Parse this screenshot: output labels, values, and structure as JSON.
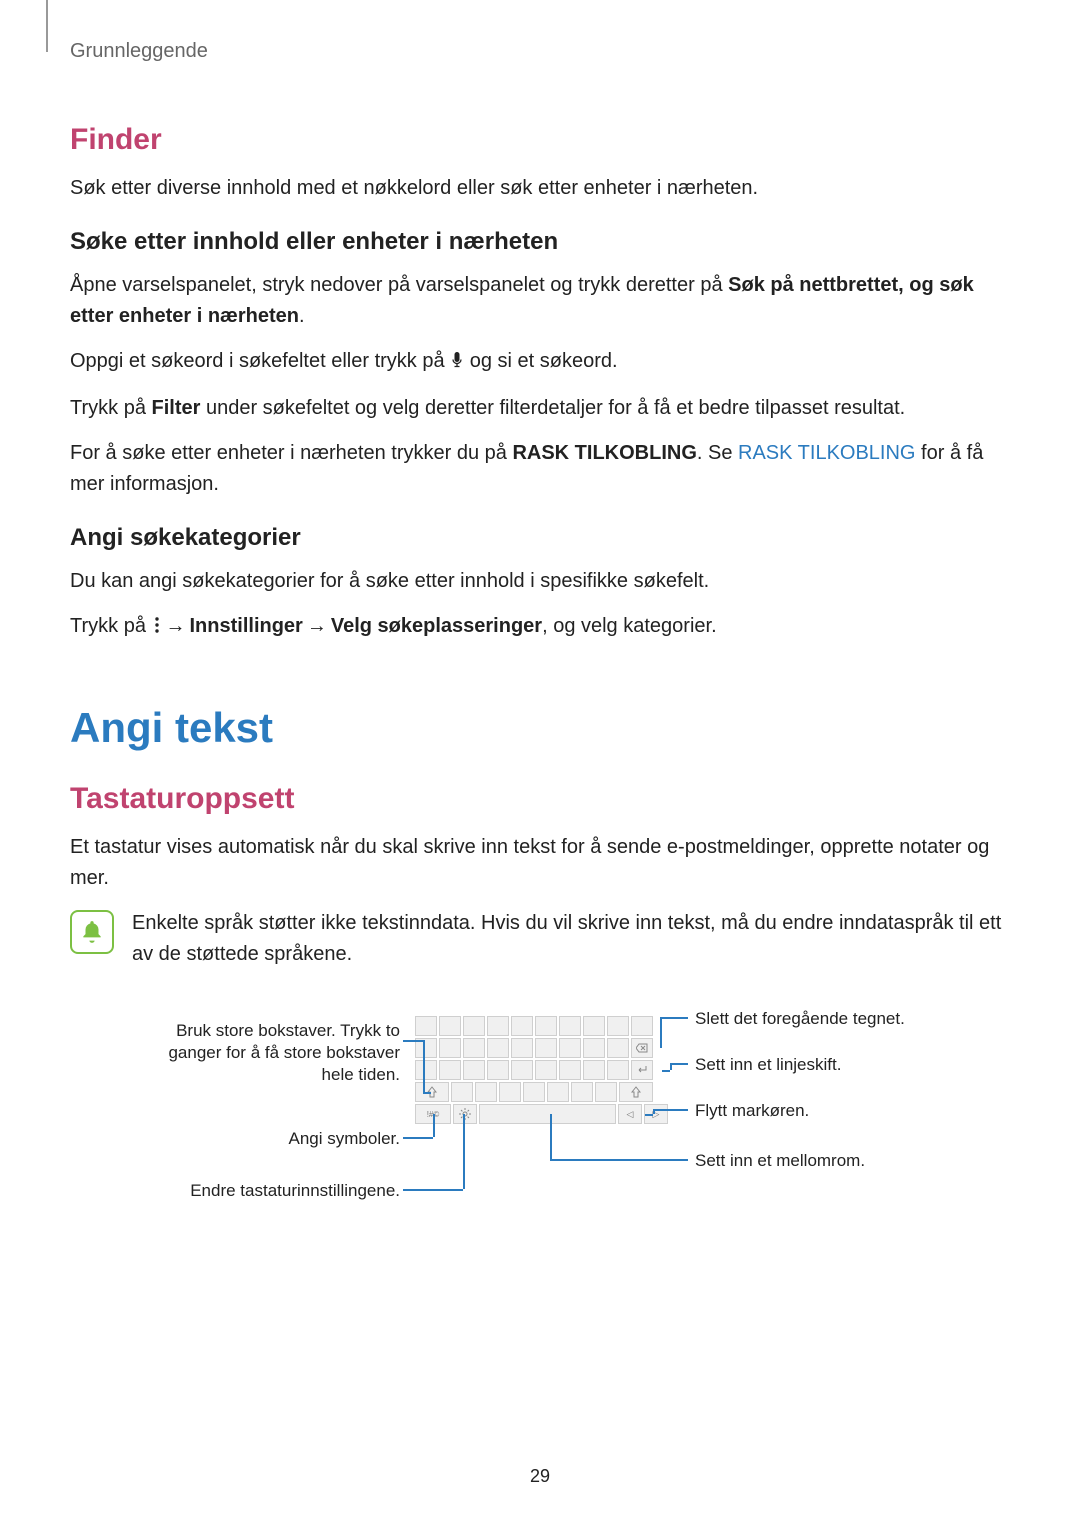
{
  "breadcrumb": "Grunnleggende",
  "finder": {
    "title": "Finder",
    "intro": "Søk etter diverse innhold med et nøkkelord eller søk etter enheter i nærheten.",
    "sub1_title": "Søke etter innhold eller enheter i nærheten",
    "sub1_p1_a": "Åpne varselspanelet, stryk nedover på varselspanelet og trykk deretter på ",
    "sub1_p1_b": "Søk på nettbrettet, og søk etter enheter i nærheten",
    "sub1_p1_c": ".",
    "sub1_p2_a": "Oppgi et søkeord i søkefeltet eller trykk på ",
    "sub1_p2_b": " og si et søkeord.",
    "sub1_p3_a": "Trykk på ",
    "sub1_p3_b": "Filter",
    "sub1_p3_c": " under søkefeltet og velg deretter filterdetaljer for å få et bedre tilpasset resultat.",
    "sub1_p4_a": "For å søke etter enheter i nærheten trykker du på ",
    "sub1_p4_b": "RASK TILKOBLING",
    "sub1_p4_c": ". Se ",
    "sub1_p4_link": "RASK TILKOBLING",
    "sub1_p4_d": " for å få mer informasjon.",
    "sub2_title": "Angi søkekategorier",
    "sub2_p1": "Du kan angi søkekategorier for å søke etter innhold i spesifikke søkefelt.",
    "sub2_p2_a": "Trykk på ",
    "sub2_p2_arrow": "→",
    "sub2_p2_b": "Innstillinger",
    "sub2_p2_c": "Velg søkeplasseringer",
    "sub2_p2_d": ", og velg kategorier."
  },
  "angi": {
    "title": "Angi tekst",
    "sub1_title": "Tastaturoppsett",
    "sub1_p1": "Et tastatur vises automatisk når du skal skrive inn tekst for å sende e-postmeldinger, opprette notater og mer.",
    "note": "Enkelte språk støtter ikke tekstinndata. Hvis du vil skrive inn tekst, må du endre inndataspråk til ett av de støttede språkene.",
    "callouts": {
      "caps_l1": "Bruk store bokstaver. Trykk to",
      "caps_l2": "ganger for å få store bokstaver",
      "caps_l3": "hele tiden.",
      "symbols": "Angi symboler.",
      "settings": "Endre tastaturinnstillingene.",
      "delete": "Slett det foregående tegnet.",
      "newline": "Sett inn et linjeskift.",
      "cursor": "Flytt markøren.",
      "space": "Sett inn et mellomrom."
    },
    "sym_key": "!#©"
  },
  "page_number": "29"
}
